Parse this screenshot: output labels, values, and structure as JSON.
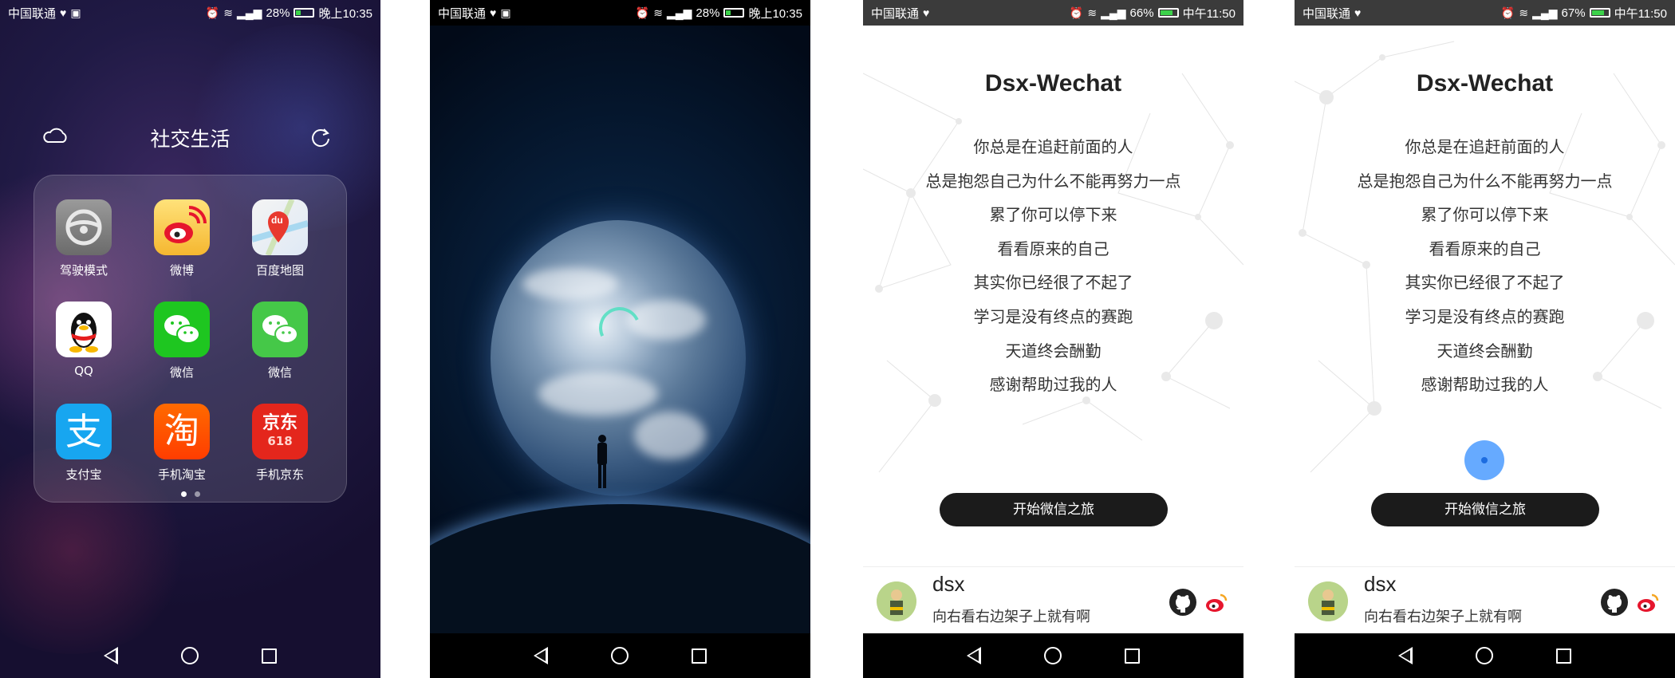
{
  "panel1": {
    "status": {
      "carrier": "中国联通",
      "battery": "28%",
      "time": "晚上10:35"
    },
    "folder_title": "社交生活",
    "apps": [
      {
        "label": "驾驶模式",
        "icon": "steering-wheel-icon"
      },
      {
        "label": "微博",
        "icon": "weibo-icon"
      },
      {
        "label": "百度地图",
        "icon": "baidu-map-icon"
      },
      {
        "label": "QQ",
        "icon": "qq-penguin-icon"
      },
      {
        "label": "微信",
        "icon": "wechat-icon"
      },
      {
        "label": "微信",
        "icon": "wechat-icon"
      },
      {
        "label": "支付宝",
        "icon": "alipay-icon"
      },
      {
        "label": "手机淘宝",
        "icon": "taobao-icon"
      },
      {
        "label": "手机京东",
        "icon": "jd-icon"
      }
    ],
    "baidu_badge": "du",
    "alipay_glyph": "支",
    "taobao_glyph": "淘",
    "jd_glyph": "京东",
    "jd_sub": "618"
  },
  "panel2": {
    "status": {
      "carrier": "中国联通",
      "battery": "28%",
      "time": "晚上10:35"
    }
  },
  "panel3": {
    "status": {
      "carrier": "中国联通",
      "battery": "66%",
      "time": "中午11:50"
    },
    "title": "Dsx-Wechat",
    "lines": [
      "你总是在追赶前面的人",
      "总是抱怨自己为什么不能再努力一点",
      "累了你可以停下来",
      "看看原来的自己",
      "其实你已经很了不起了",
      "学习是没有终点的赛跑",
      "天道终会酬勤",
      "感谢帮助过我的人"
    ],
    "button": "开始微信之旅",
    "footer": {
      "name": "dsx",
      "subtitle": "向右看右边架子上就有啊"
    }
  },
  "panel4": {
    "status": {
      "carrier": "中国联通",
      "battery": "67%",
      "time": "中午11:50"
    },
    "title": "Dsx-Wechat",
    "lines": [
      "你总是在追赶前面的人",
      "总是抱怨自己为什么不能再努力一点",
      "累了你可以停下来",
      "看看原来的自己",
      "其实你已经很了不起了",
      "学习是没有终点的赛跑",
      "天道终会酬勤",
      "感谢帮助过我的人"
    ],
    "button": "开始微信之旅",
    "footer": {
      "name": "dsx",
      "subtitle": "向右看右边架子上就有啊"
    }
  },
  "colors": {
    "wechat_green": "#3cd24a",
    "button_dark": "#1b1b1b",
    "loader_blue": "#66aaff"
  }
}
